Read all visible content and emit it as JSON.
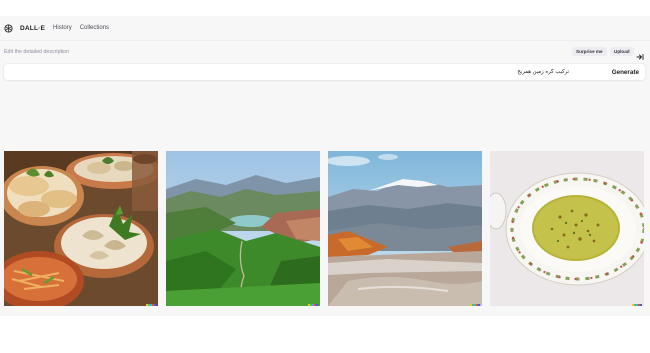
{
  "nav": {
    "brand": "DALL·E",
    "links": [
      "History",
      "Collections"
    ]
  },
  "prompt": {
    "label": "Edit the detailed description",
    "value": "ترکیب گره زمین همریخ",
    "generate_label": "Generate"
  },
  "actions": {
    "surprise_label": "Surprise me",
    "upload_label": "Upload"
  },
  "images": [
    {
      "subject": "plates of dumplings and flatbread"
    },
    {
      "subject": "green mountain valley with lake"
    },
    {
      "subject": "snowy mountains over a dry riverbed"
    },
    {
      "subject": "herb rice dish on a floral plate"
    }
  ],
  "colors": {
    "accent": "#202123",
    "background": "#f7f7f8",
    "pill": "#ececf1"
  }
}
